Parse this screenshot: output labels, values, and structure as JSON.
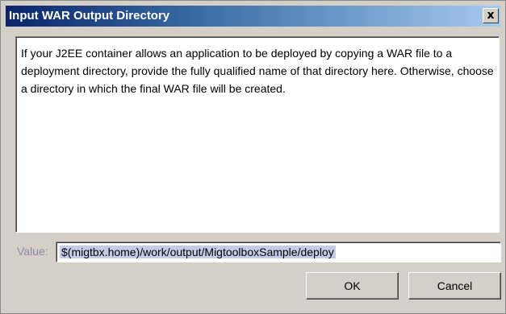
{
  "window": {
    "title": "Input WAR Output Directory",
    "close_label": "x"
  },
  "description": {
    "text": "If your J2EE container allows an application to be deployed by copying a WAR file to a deployment directory, provide the fully qualified name of that directory here.  Otherwise, choose a directory in which the final WAR file will be created."
  },
  "value_field": {
    "label": "Value:",
    "value": "$(migtbx.home)/work/output/MigtoolboxSample/deploy"
  },
  "buttons": {
    "ok_label": "OK",
    "cancel_label": "Cancel"
  },
  "colors": {
    "titlebar_start": "#0a246a",
    "titlebar_end": "#a6caf0",
    "dialog_bg": "#d4d0c8",
    "selection_bg": "#c4cde8"
  }
}
